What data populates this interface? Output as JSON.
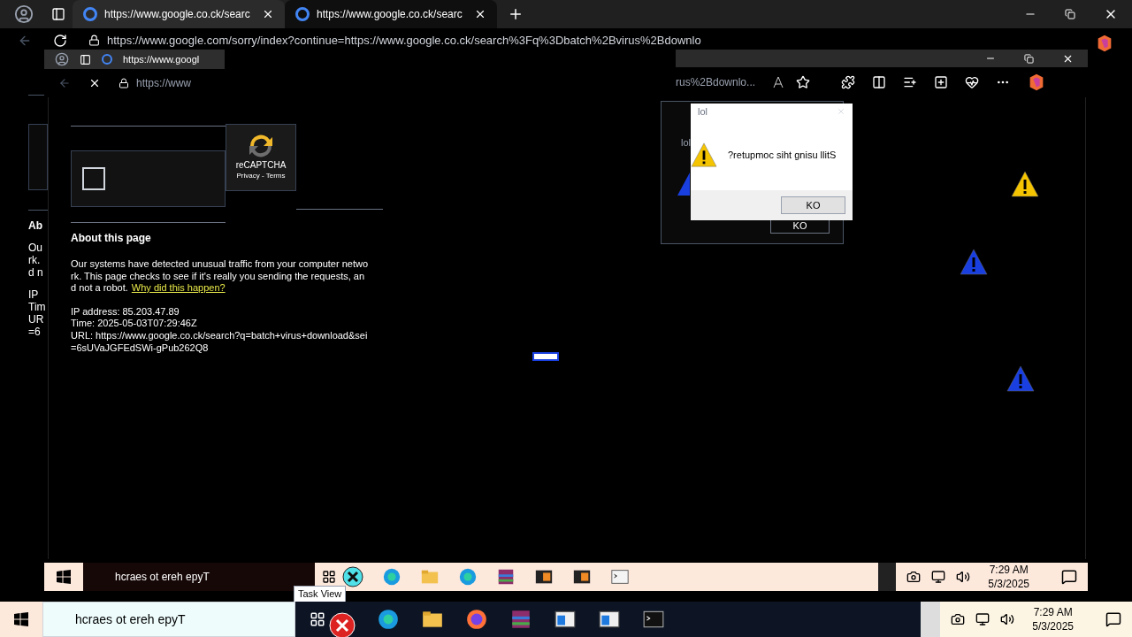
{
  "browser": {
    "tabs": [
      {
        "title": "https://www.google.co.ck/searc",
        "selected": false
      },
      {
        "title": "https://www.google.co.ck/searc",
        "selected": true
      }
    ],
    "address": "https://www.google.com/sorry/index?continue=https://www.google.co.ck/search%3Fq%3Dbatch%2Bvirus%2Bdownlo"
  },
  "background_page": {
    "heading": "Ab",
    "lines": [
      "Ou",
      "rk.",
      "d n"
    ],
    "details": [
      "IP",
      "Tim",
      "UR",
      "=6"
    ]
  },
  "inner_browser": {
    "tab": "https://www.googl",
    "address": "https://www",
    "address_tail": "rus%2Bdownlo..."
  },
  "captcha": {
    "checked": false,
    "brand": "reCAPTCHA",
    "links": "Privacy - Terms"
  },
  "about": {
    "heading": "About this page",
    "lines": [
      "Our systems have detected unusual traffic from your computer netwo",
      "rk. This page checks to see if it's really you sending the requests, an",
      "d not a robot."
    ],
    "link": "Why did this happen?",
    "details": [
      "IP address: 85.203.47.89",
      "Time: 2025-05-03T07:29:46Z",
      "URL: https://www.google.co.ck/search?q=batch+virus+download&sei",
      "=6sUVaJGFEdSWi-gPub262Q8"
    ]
  },
  "back_dialog": {
    "title": "lol",
    "button": "KO"
  },
  "dialog": {
    "title": "lol",
    "message": "?retupmoc siht gnisu llitS",
    "button": "KO"
  },
  "warning_icons": [
    {
      "color": "#f5c400"
    },
    {
      "color": "#1a3fe0"
    },
    {
      "color": "#1a3fe0"
    }
  ],
  "inner_taskbar": {
    "search_placeholder": "hcraes ot ereh epyT",
    "tooltip": "Task View",
    "time": "7:29 AM",
    "date": "5/3/2025"
  },
  "taskbar": {
    "search_placeholder": "hcraes ot ereh epyT",
    "time": "7:29 AM",
    "date": "5/3/2025"
  }
}
